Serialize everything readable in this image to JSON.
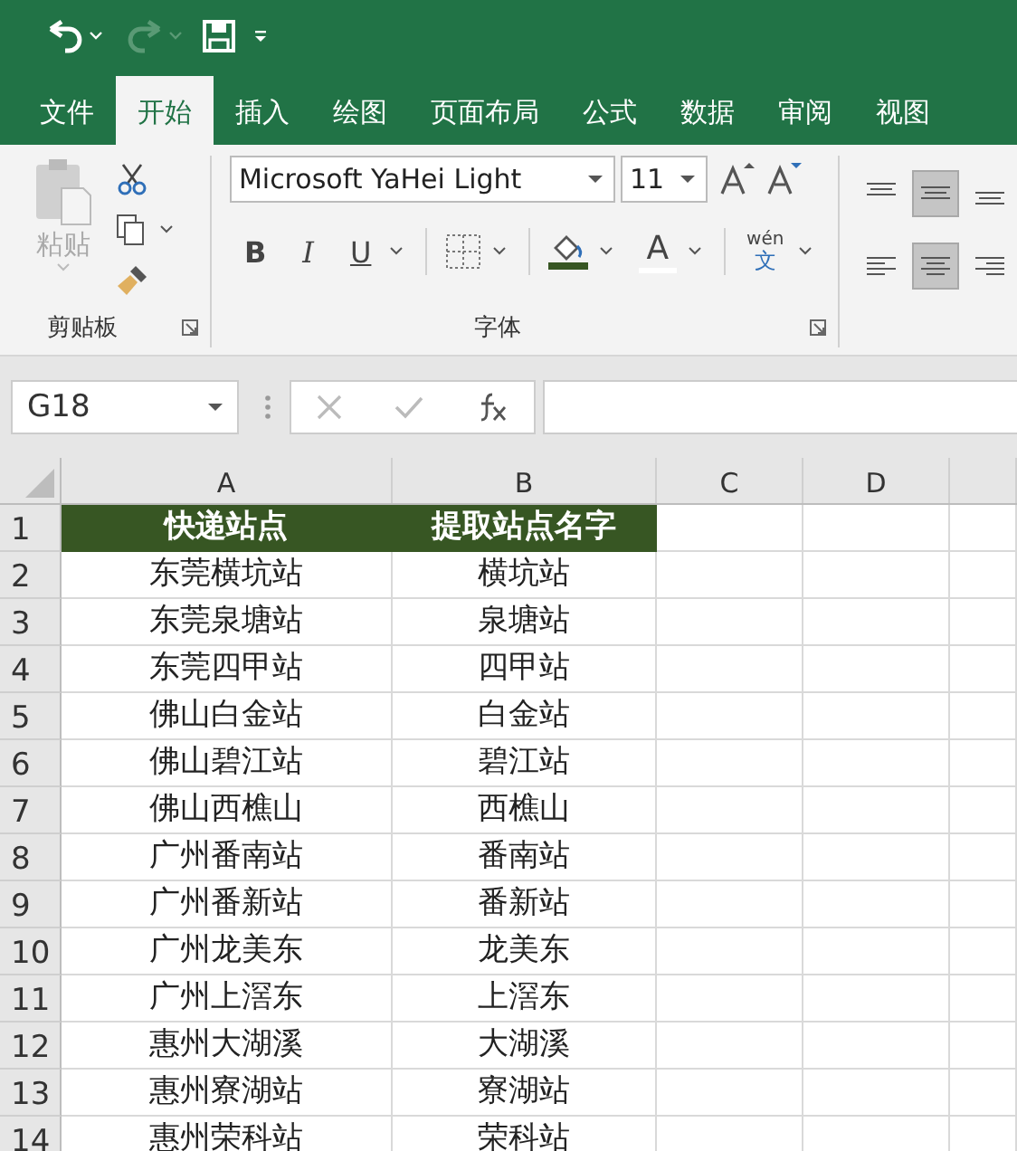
{
  "quick_access": [
    {
      "kind": "undo",
      "disabled": false
    },
    {
      "kind": "redo",
      "disabled": true
    },
    {
      "kind": "save",
      "disabled": false
    },
    {
      "kind": "customize",
      "disabled": false
    }
  ],
  "tabs": [
    {
      "label": "文件",
      "selected": false
    },
    {
      "label": "开始",
      "selected": true
    },
    {
      "label": "插入",
      "selected": false
    },
    {
      "label": "绘图",
      "selected": false
    },
    {
      "label": "页面布局",
      "selected": false
    },
    {
      "label": "公式",
      "selected": false
    },
    {
      "label": "数据",
      "selected": false
    },
    {
      "label": "审阅",
      "selected": false
    },
    {
      "label": "视图",
      "selected": false
    }
  ],
  "clipboard": {
    "label": "剪贴板",
    "paste": {
      "label": "粘贴",
      "disabled": true
    }
  },
  "font": {
    "label": "字体",
    "font_name": "Microsoft YaHei Light",
    "font_size": "11",
    "phonetic_top": "wén",
    "phonetic_bottom": "文",
    "bold": "B",
    "italic": "I",
    "underline": "U",
    "font_color_glyph": "A"
  },
  "alignment": [
    {
      "kind": "top",
      "selected": false
    },
    {
      "kind": "middle",
      "selected": true
    },
    {
      "kind": "bottom",
      "selected": false
    },
    {
      "kind": "left",
      "selected": false
    },
    {
      "kind": "center",
      "selected": true
    },
    {
      "kind": "right",
      "selected": false
    }
  ],
  "name_box": "G18",
  "columns": [
    "A",
    "B",
    "C",
    "D"
  ],
  "rows": [
    {
      "number": "1",
      "kind": "header",
      "cells": [
        "快递站点",
        "提取站点名字"
      ]
    },
    {
      "number": "2",
      "kind": "data",
      "cells": [
        "东莞横坑站",
        "横坑站"
      ]
    },
    {
      "number": "3",
      "kind": "data",
      "cells": [
        "东莞泉塘站",
        "泉塘站"
      ]
    },
    {
      "number": "4",
      "kind": "data",
      "cells": [
        "东莞四甲站",
        "四甲站"
      ]
    },
    {
      "number": "5",
      "kind": "data",
      "cells": [
        "佛山白金站",
        "白金站"
      ]
    },
    {
      "number": "6",
      "kind": "data",
      "cells": [
        "佛山碧江站",
        "碧江站"
      ]
    },
    {
      "number": "7",
      "kind": "data",
      "cells": [
        "佛山西樵山",
        "西樵山"
      ]
    },
    {
      "number": "8",
      "kind": "data",
      "cells": [
        "广州番南站",
        "番南站"
      ]
    },
    {
      "number": "9",
      "kind": "data",
      "cells": [
        "广州番新站",
        "番新站"
      ]
    },
    {
      "number": "10",
      "kind": "data",
      "cells": [
        "广州龙美东",
        "龙美东"
      ]
    },
    {
      "number": "11",
      "kind": "data",
      "cells": [
        "广州上滘东",
        "上滘东"
      ]
    },
    {
      "number": "12",
      "kind": "data",
      "cells": [
        "惠州大湖溪",
        "大湖溪"
      ]
    },
    {
      "number": "13",
      "kind": "data",
      "cells": [
        "惠州寮湖站",
        "寮湖站"
      ]
    },
    {
      "number": "14",
      "kind": "data",
      "cells": [
        "惠州荣科站",
        "荣科站"
      ]
    }
  ]
}
